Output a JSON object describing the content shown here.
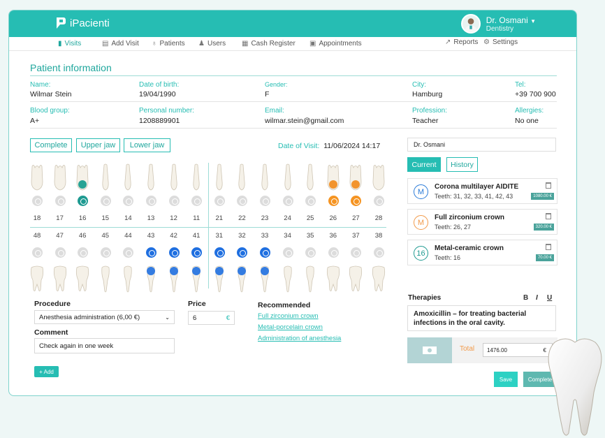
{
  "app": {
    "name": "iPacienti"
  },
  "user": {
    "name": "Dr. Osmani",
    "specialty": "Dentistry"
  },
  "nav": {
    "items": [
      {
        "label": "Visits",
        "icon": "document-icon",
        "active": true
      },
      {
        "label": "Add Visit",
        "icon": "add-document-icon"
      },
      {
        "label": "Patients",
        "icon": "stethoscope-icon"
      },
      {
        "label": "Users",
        "icon": "users-icon"
      },
      {
        "label": "Cash Register",
        "icon": "cash-register-icon"
      },
      {
        "label": "Appointments",
        "icon": "calendar-icon"
      }
    ],
    "right": [
      {
        "label": "Reports",
        "icon": "chart-icon"
      },
      {
        "label": "Settings",
        "icon": "gear-icon"
      }
    ]
  },
  "patient": {
    "section_title": "Patient information",
    "name_label": "Name:",
    "name": "Wilmar Stein",
    "dob_label": "Date of birth:",
    "dob": "19/04/1990",
    "gender_label": "Gender:",
    "gender": "F",
    "city_label": "City:",
    "city": "Hamburg",
    "tel_label": "Tel:",
    "tel": "+39 700 900",
    "blood_label": "Blood group:",
    "blood": "A+",
    "personal_label": "Personal number:",
    "personal": "1208889901",
    "email_label": "Email:",
    "email": "wilmar.stein@gmail.com",
    "profession_label": "Profession:",
    "profession": "Teacher",
    "allergies_label": "Allergies:",
    "allergies": "No one"
  },
  "jaw_buttons": {
    "complete": "Complete",
    "upper": "Upper jaw",
    "lower": "Lower jaw"
  },
  "visit": {
    "label": "Date of Visit:",
    "value": "11/06/2024 14:17"
  },
  "teeth": {
    "upper": [
      {
        "n": "18",
        "state": "none"
      },
      {
        "n": "17",
        "state": "none"
      },
      {
        "n": "16",
        "state": "teal"
      },
      {
        "n": "15",
        "state": "none"
      },
      {
        "n": "14",
        "state": "none"
      },
      {
        "n": "13",
        "state": "none"
      },
      {
        "n": "12",
        "state": "none"
      },
      {
        "n": "11",
        "state": "none"
      },
      {
        "n": "21",
        "state": "none"
      },
      {
        "n": "22",
        "state": "none"
      },
      {
        "n": "23",
        "state": "none"
      },
      {
        "n": "24",
        "state": "none"
      },
      {
        "n": "25",
        "state": "none"
      },
      {
        "n": "26",
        "state": "orange"
      },
      {
        "n": "27",
        "state": "orange"
      },
      {
        "n": "28",
        "state": "none"
      }
    ],
    "lower": [
      {
        "n": "48",
        "state": "none"
      },
      {
        "n": "47",
        "state": "none"
      },
      {
        "n": "46",
        "state": "none"
      },
      {
        "n": "45",
        "state": "none"
      },
      {
        "n": "44",
        "state": "none"
      },
      {
        "n": "43",
        "state": "blue"
      },
      {
        "n": "42",
        "state": "blue"
      },
      {
        "n": "41",
        "state": "blue"
      },
      {
        "n": "31",
        "state": "blue"
      },
      {
        "n": "32",
        "state": "blue"
      },
      {
        "n": "33",
        "state": "blue"
      },
      {
        "n": "34",
        "state": "none"
      },
      {
        "n": "35",
        "state": "none"
      },
      {
        "n": "36",
        "state": "none"
      },
      {
        "n": "37",
        "state": "none"
      },
      {
        "n": "38",
        "state": "none"
      }
    ]
  },
  "procedure": {
    "label": "Procedure",
    "value": "Anesthesia administration (6,00 €)"
  },
  "price": {
    "label": "Price",
    "value": "6",
    "currency": "€"
  },
  "comment": {
    "label": "Comment",
    "value": "Check again in one week"
  },
  "recommended": {
    "label": "Recommended",
    "links": [
      "Full zirconium crown",
      "Metal-porcelain crown",
      "Administration of anesthesia"
    ]
  },
  "add_button": "+ Add",
  "doctor_field": "Dr. Osmani",
  "tabs": {
    "current": "Current",
    "history": "History"
  },
  "treatments": [
    {
      "badge": "M",
      "color": "#2a7bd8",
      "title": "Corona multilayer AIDITE",
      "teeth": "Teeth: 31, 32, 33, 41, 42, 43",
      "price": "1080.00 €"
    },
    {
      "badge": "M",
      "color": "#f29a4a",
      "title": "Full zirconium crown",
      "teeth": "Teeth: 26, 27",
      "price": "320.00 €"
    },
    {
      "badge": "16",
      "color": "#1e9a91",
      "title": "Metal-ceramic crown",
      "teeth": "Teeth: 16",
      "price": "70.00 €"
    }
  ],
  "therapies": {
    "label": "Therapies",
    "text": "Amoxicillin – for treating bacterial infections in the oral cavity.",
    "format": [
      "B",
      "I",
      "U"
    ]
  },
  "total": {
    "label": "Total",
    "value": "1476.00",
    "currency": "€"
  },
  "actions": {
    "save": "Save",
    "complete": "Complete"
  }
}
